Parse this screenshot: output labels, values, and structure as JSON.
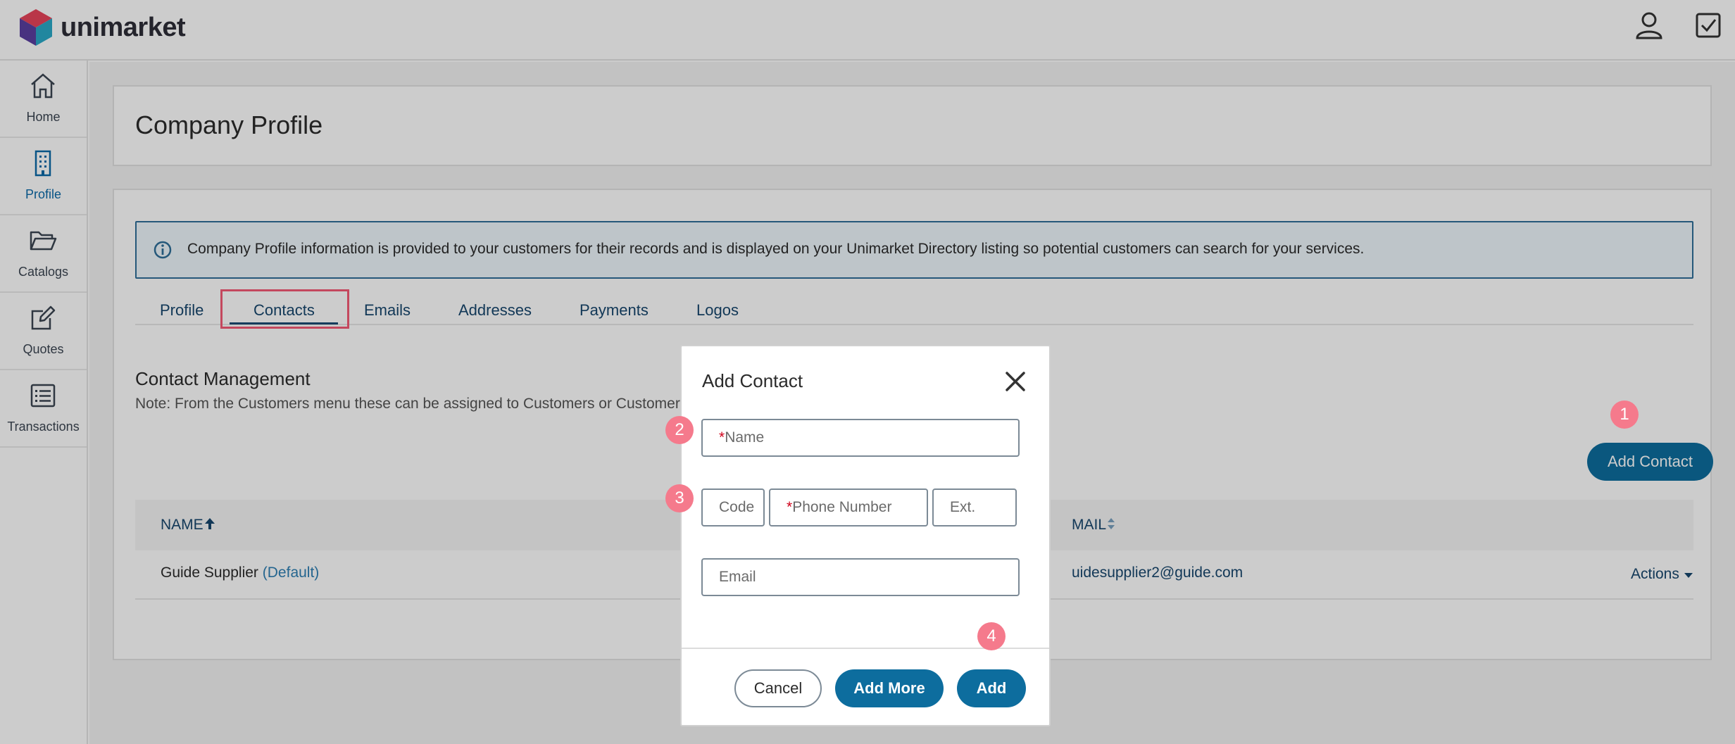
{
  "app": {
    "brand": "unimarket"
  },
  "sidebar": {
    "items": [
      {
        "label": "Home",
        "icon": "home-icon"
      },
      {
        "label": "Profile",
        "icon": "building-icon"
      },
      {
        "label": "Catalogs",
        "icon": "folder-icon"
      },
      {
        "label": "Quotes",
        "icon": "edit-icon"
      },
      {
        "label": "Transactions",
        "icon": "list-icon"
      }
    ]
  },
  "page": {
    "title": "Company Profile"
  },
  "info": {
    "text": "Company Profile information is provided to your customers for their records and is displayed on your Unimarket Directory listing so potential customers can search for your services."
  },
  "tabs": [
    {
      "label": "Profile"
    },
    {
      "label": "Contacts"
    },
    {
      "label": "Emails"
    },
    {
      "label": "Addresses"
    },
    {
      "label": "Payments"
    },
    {
      "label": "Logos"
    }
  ],
  "contacts": {
    "title": "Contact Management",
    "note": "Note: From the Customers menu these can be assigned to Customers or Customer",
    "add_button": "Add Contact",
    "table": {
      "headers": {
        "name": "NAME",
        "email": "MAIL"
      },
      "rows": [
        {
          "name": "Guide Supplier",
          "tag": "(Default)",
          "email": "uidesupplier2@guide.com",
          "actions": "Actions"
        }
      ]
    }
  },
  "modal": {
    "title": "Add Contact",
    "name_placeholder": "Name",
    "code_placeholder": "Code",
    "phone_placeholder": "Phone Number",
    "ext_placeholder": "Ext.",
    "email_placeholder": "Email",
    "required_mark": "*",
    "cancel": "Cancel",
    "add_more": "Add More",
    "add": "Add"
  },
  "badges": [
    "1",
    "2",
    "3",
    "4"
  ],
  "colors": {
    "accent": "#0d6d9e",
    "badge": "#f57a8c",
    "highlight": "#f55a76"
  }
}
